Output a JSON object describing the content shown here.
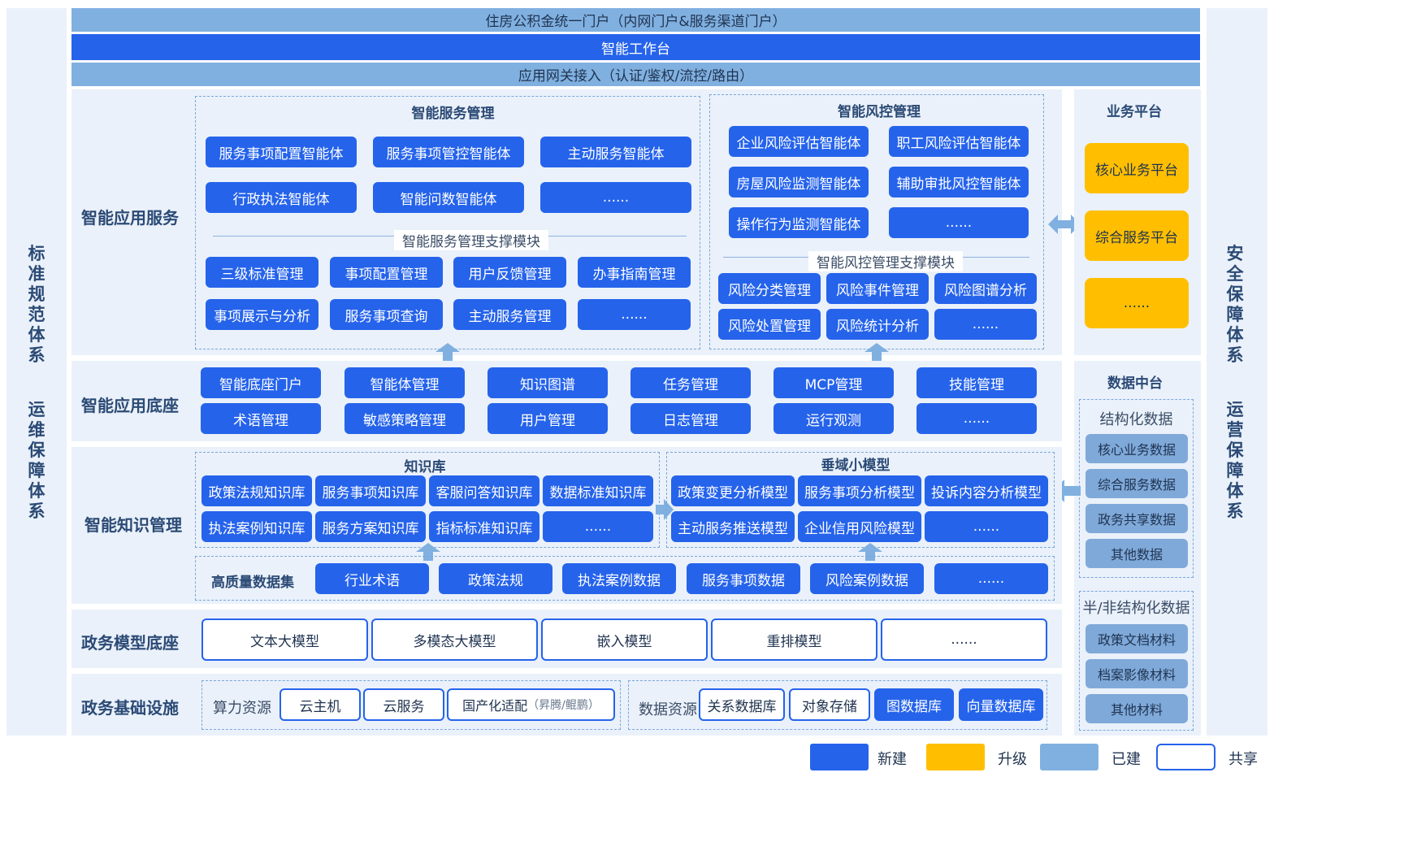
{
  "left_side": {
    "top": "标准规范体系",
    "bottom": "运维保障体系"
  },
  "right_side": {
    "top": "安全保障体系",
    "bottom": "运营保障体系"
  },
  "top_bars": [
    "住房公积金统一门户（内网门户&服务渠道门户）",
    "智能工作台",
    "应用网关接入（认证/鉴权/流控/路由）"
  ],
  "bands": {
    "app_service": "智能应用服务",
    "app_base": "智能应用底座",
    "knowledge": "智能知识管理",
    "model_base": "政务模型底座",
    "infra": "政务基础设施"
  },
  "smart_service": {
    "title": "智能服务管理",
    "agents": [
      "服务事项配置智能体",
      "服务事项管控智能体",
      "主动服务智能体",
      "行政执法智能体",
      "智能问数智能体",
      "......"
    ],
    "support_title": "智能服务管理支撑模块",
    "modules": [
      "三级标准管理",
      "事项配置管理",
      "用户反馈管理",
      "办事指南管理",
      "事项展示与分析",
      "服务事项查询",
      "主动服务管理",
      "......"
    ]
  },
  "risk_control": {
    "title": "智能风控管理",
    "agents": [
      "企业风险评估智能体",
      "职工风险评估智能体",
      "房屋风险监测智能体",
      "辅助审批风控智能体",
      "操作行为监测智能体",
      "......"
    ],
    "support_title": "智能风控管理支撑模块",
    "modules": [
      "风险分类管理",
      "风险事件管理",
      "风险图谱分析",
      "风险处置管理",
      "风险统计分析",
      "......"
    ]
  },
  "business_platform": {
    "title": "业务平台",
    "items": [
      "核心业务平台",
      "综合服务平台",
      "......"
    ]
  },
  "app_base_items": [
    "智能底座门户",
    "智能体管理",
    "知识图谱",
    "任务管理",
    "MCP管理",
    "技能管理",
    "术语管理",
    "敏感策略管理",
    "用户管理",
    "日志管理",
    "运行观测",
    "......"
  ],
  "data_platform": {
    "title": "数据中台",
    "structured_title": "结构化数据",
    "structured": [
      "核心业务数据",
      "综合服务数据",
      "政务共享数据",
      "其他数据"
    ],
    "unstructured_title": "半/非结构化数据",
    "unstructured": [
      "政策文档材料",
      "档案影像材料",
      "其他材料"
    ]
  },
  "knowledge_base": {
    "title": "知识库",
    "items": [
      "政策法规知识库",
      "服务事项知识库",
      "客服问答知识库",
      "数据标准知识库",
      "执法案例知识库",
      "服务方案知识库",
      "指标标准知识库",
      "......"
    ]
  },
  "vertical_models": {
    "title": "垂域小模型",
    "items": [
      "政策变更分析模型",
      "服务事项分析模型",
      "投诉内容分析模型",
      "主动服务推送模型",
      "企业信用风险模型",
      "......"
    ]
  },
  "dataset": {
    "label": "高质量数据集",
    "items": [
      "行业术语",
      "政策法规",
      "执法案例数据",
      "服务事项数据",
      "风险案例数据",
      "......"
    ]
  },
  "models": [
    "文本大模型",
    "多模态大模型",
    "嵌入模型",
    "重排模型",
    "......"
  ],
  "compute": {
    "label": "算力资源",
    "items": [
      "云主机",
      "云服务"
    ],
    "domestic": "国产化适配",
    "domestic_note": "（昇腾/鲲鹏）"
  },
  "data_resource": {
    "label": "数据资源",
    "shared": [
      "关系数据库",
      "对象存储"
    ],
    "new": [
      "图数据库",
      "向量数据库"
    ]
  },
  "legend": [
    "新建",
    "升级",
    "已建",
    "共享"
  ],
  "colors": {
    "new": "#2563eb",
    "upgrade": "#ffbf00",
    "built": "#80b0e0",
    "shared": "#ffffff"
  }
}
